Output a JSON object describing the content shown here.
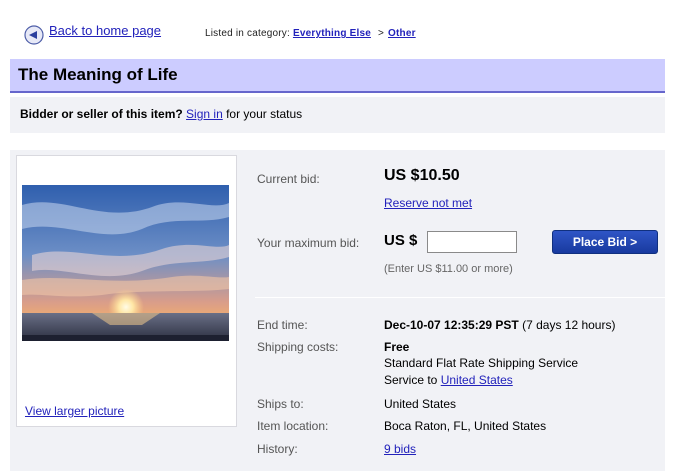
{
  "nav": {
    "back_label": "Back to home page",
    "listed_prefix": "Listed in category:",
    "category": "Everything Else",
    "separator": ">",
    "subcategory": "Other"
  },
  "item": {
    "title": "The Meaning of Life"
  },
  "status": {
    "question": "Bidder or seller of this item?",
    "sign_in": "Sign in",
    "suffix": "for your status"
  },
  "picture": {
    "view_larger": "View larger picture",
    "subject": "sunset over sea"
  },
  "bid": {
    "current_label": "Current bid:",
    "current_value": "US $10.50",
    "reserve": "Reserve not met",
    "max_label": "Your maximum bid:",
    "max_prefix": "US $",
    "max_value": "",
    "button": "Place Bid >",
    "hint": "(Enter US $11.00 or more)"
  },
  "details": {
    "end_label": "End time:",
    "end_value": "Dec-10-07 12:35:29 PST",
    "end_suffix": "(7 days 12 hours)",
    "shipping_label": "Shipping costs:",
    "shipping_value": "Free",
    "shipping_service": "Standard Flat Rate Shipping Service",
    "service_to": "Service to",
    "service_to_link": "United States",
    "ships_label": "Ships to:",
    "ships_value": "United States",
    "location_label": "Item location:",
    "location_value": "Boca Raton, FL, United States",
    "history_label": "History:",
    "history_value": "9 bids"
  },
  "colors": {
    "link": "#2222bb",
    "title_bar": "#ccccff",
    "title_bar_border": "#6666cc",
    "panel": "#f1f2f6",
    "button": "#2f55c6"
  }
}
